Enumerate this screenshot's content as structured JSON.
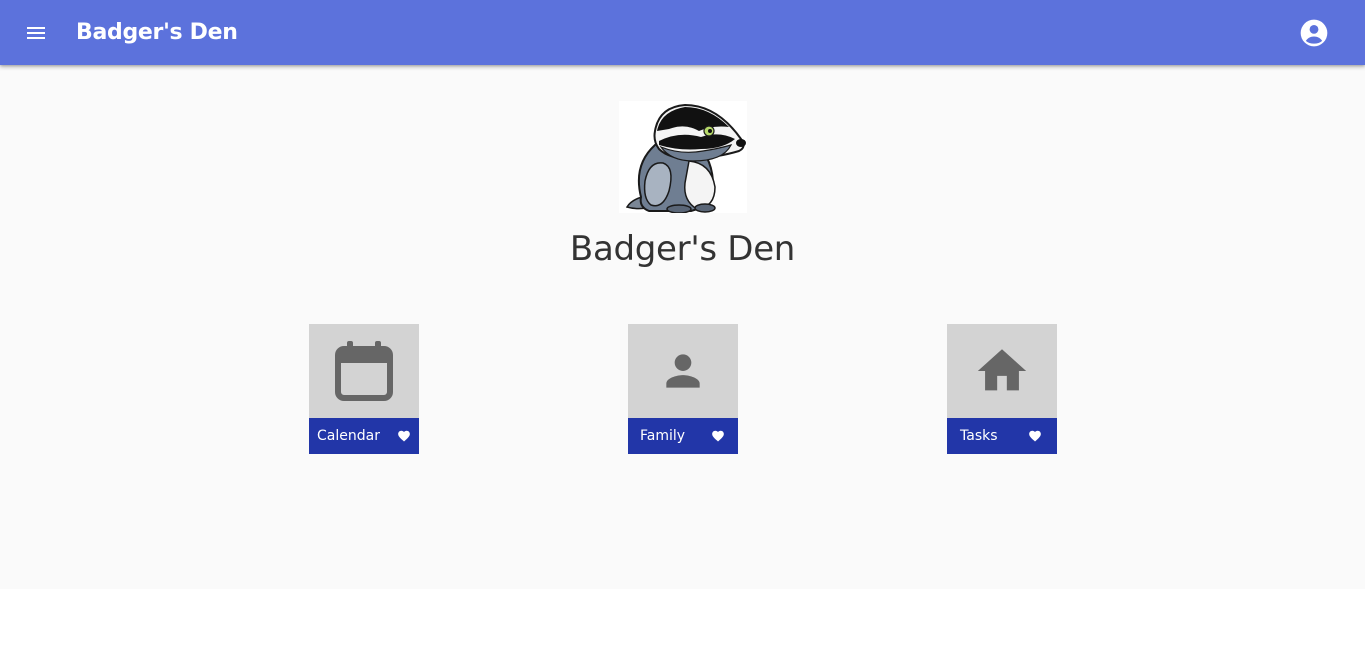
{
  "toolbar": {
    "title": "Badger's Den",
    "menu_icon": "menu-icon",
    "account_icon": "account-circle-icon",
    "background_color": "#5c72dc"
  },
  "main": {
    "logo": "badger-mascot-logo",
    "title": "Badger's Den"
  },
  "tiles": [
    {
      "label": "Calendar",
      "icon": "calendar-icon",
      "favorite_icon": "heart-icon"
    },
    {
      "label": "Family",
      "icon": "person-icon",
      "favorite_icon": "heart-icon"
    },
    {
      "label": "Tasks",
      "icon": "home-icon",
      "favorite_icon": "heart-icon"
    }
  ],
  "colors": {
    "tile_bar": "#2236a8",
    "tile_background": "#d3d3d3",
    "icon_gray": "#666666"
  }
}
